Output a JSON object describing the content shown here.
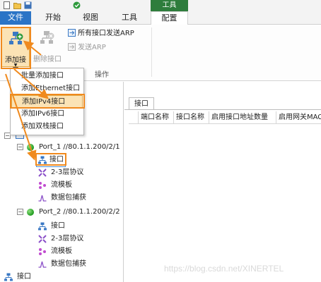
{
  "ribbon_tabs": {
    "file": "文件",
    "start": "开始",
    "view": "视图",
    "tools": "工具",
    "config": "配置",
    "tool_group": "工具"
  },
  "ribbon": {
    "add_interface": "添加接口",
    "delete_interface": "删除接口",
    "send_arp_all": "所有接口发送ARP",
    "send_arp": "发送ARP",
    "group_label": "操作"
  },
  "menu": {
    "items": [
      "批量添加接口",
      "添加Ethernet接口",
      "添加IPv4接口",
      "添加IPv6接口",
      "添加双栈接口"
    ],
    "highlighted": "添加IPv4接口"
  },
  "tree": {
    "port1": "Port_1 //80.1.1.200/2/1",
    "port2": "Port_2 //80.1.1.200/2/2",
    "interface": "接口",
    "protocol": "2-3层协议",
    "stream": "流模板",
    "capture": "数据包捕获",
    "bottom_interface": "接口"
  },
  "right_panel": {
    "tab": "接口",
    "columns": [
      "端口名称",
      "接口名称",
      "启用接口地址数量",
      "启用网关MAC"
    ]
  },
  "watermark": "https://blog.csdn.net/XINERTEL",
  "colors": {
    "accent_orange": "#f08a1e",
    "file_tab": "#2b74c6",
    "tool_green": "#2e7d3c",
    "highlight": "#fbe3b5"
  }
}
